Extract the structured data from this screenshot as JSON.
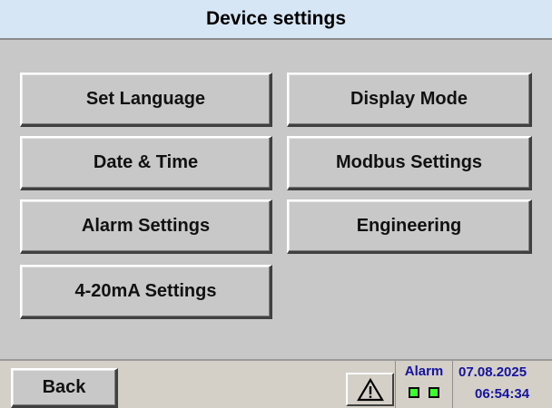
{
  "header": {
    "title": "Device settings"
  },
  "menu": {
    "set_language": "Set Language",
    "display_mode": "Display Mode",
    "date_time": "Date & Time",
    "modbus_settings": "Modbus Settings",
    "alarm_settings": "Alarm Settings",
    "engineering": "Engineering",
    "ma_settings": "4-20mA Settings"
  },
  "statusbar": {
    "back_label": "Back",
    "alarm_icon": "warning-triangle-icon",
    "alarm_label": "Alarm",
    "alarm_leds": [
      "on",
      "on"
    ],
    "date": "07.08.2025",
    "time": "06:54:34"
  },
  "colors": {
    "titlebar_bg": "#d7e6f5",
    "content_bg": "#c8c8c8",
    "status_text": "#1414a0",
    "led_on": "#39ff2e"
  }
}
